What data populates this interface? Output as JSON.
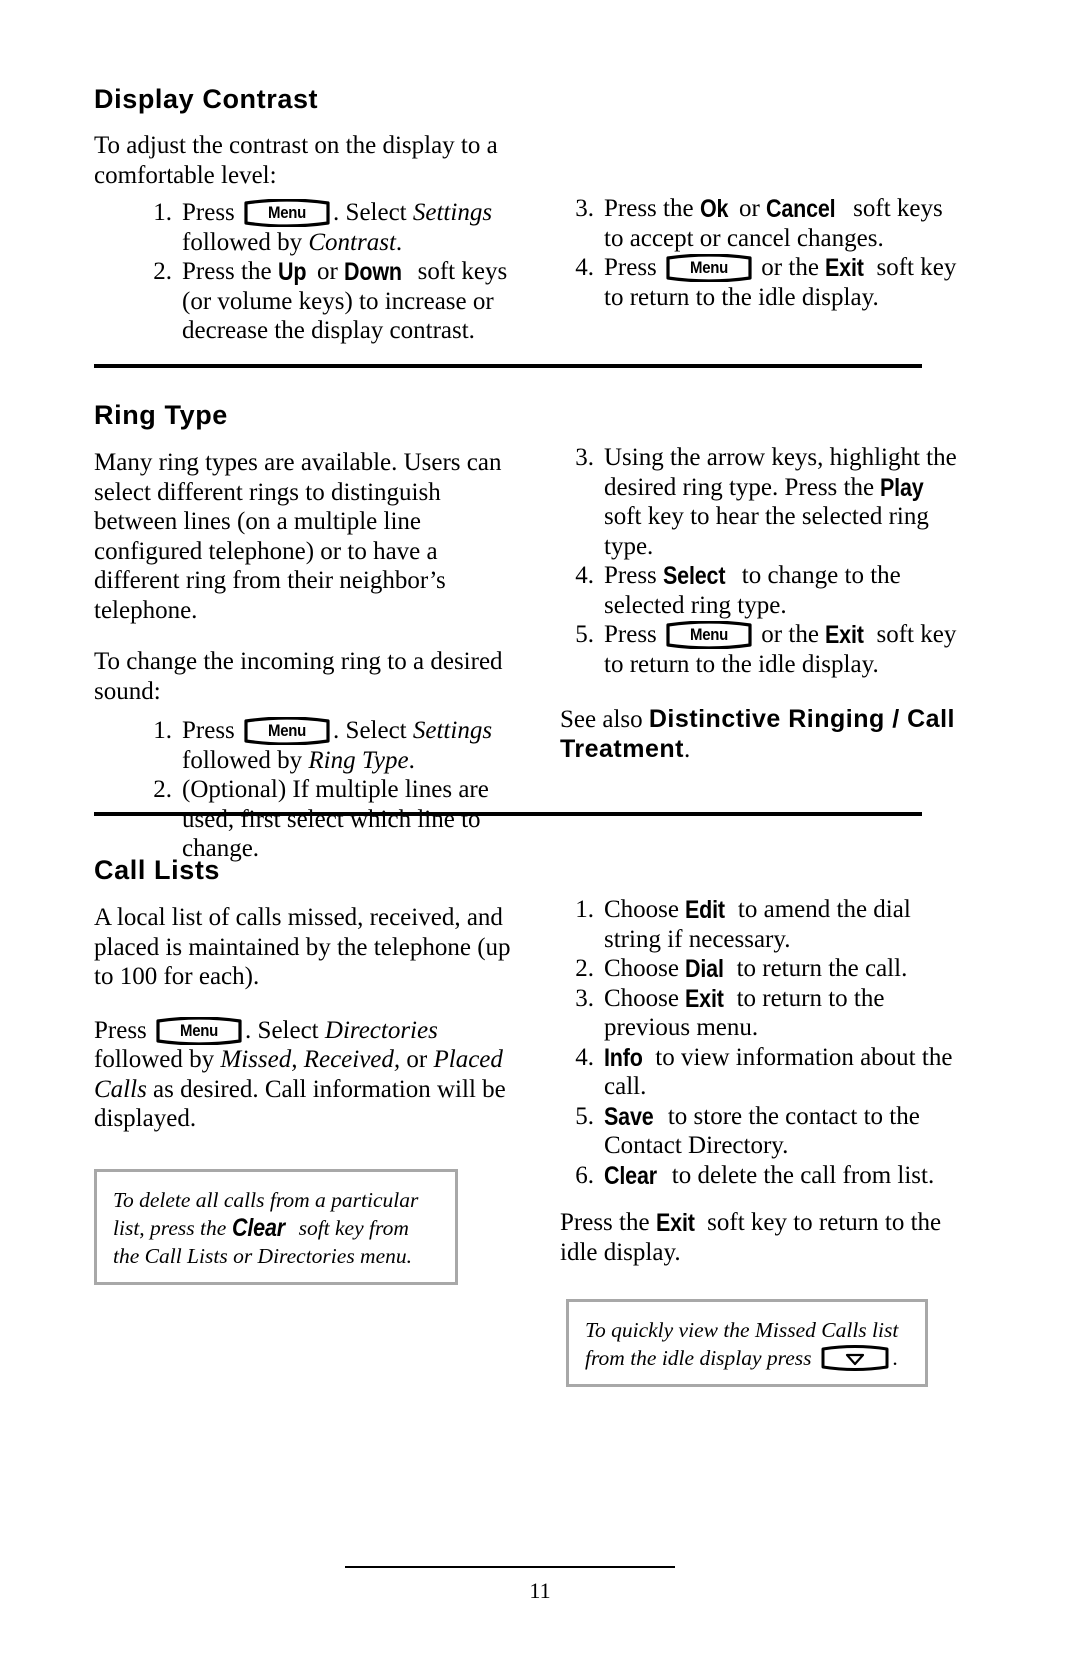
{
  "page": {
    "folio": "11",
    "menu_key_label": "Menu",
    "arrow_key_icon": "down-arrow-key-icon"
  },
  "sections": [
    {
      "id": "display-contrast",
      "heading": "Display Contrast",
      "intro": "To adjust the contrast on the display to a comfortable level:",
      "steps_left": [
        {
          "num": "1.",
          "parts": [
            {
              "t": "text",
              "v": "Press "
            },
            {
              "t": "key",
              "v": "Menu"
            },
            {
              "t": "text",
              "v": ". Select "
            },
            {
              "t": "italic",
              "v": "Settings"
            },
            {
              "t": "text",
              "v": " followed by "
            },
            {
              "t": "italic",
              "v": "Contrast"
            },
            {
              "t": "text",
              "v": "."
            }
          ]
        },
        {
          "num": "2.",
          "parts": [
            {
              "t": "text",
              "v": "Press the "
            },
            {
              "t": "softkey",
              "v": "Up"
            },
            {
              "t": "text",
              "v": " or "
            },
            {
              "t": "softkey",
              "v": "Down"
            },
            {
              "t": "text",
              "v": " soft keys (or volume keys) to increase or decrease the display contrast."
            }
          ]
        }
      ],
      "steps_right": [
        {
          "num": "3.",
          "parts": [
            {
              "t": "text",
              "v": "Press the "
            },
            {
              "t": "softkey",
              "v": "Ok"
            },
            {
              "t": "text",
              "v": " or "
            },
            {
              "t": "softkey",
              "v": "Cancel"
            },
            {
              "t": "text",
              "v": " soft keys to accept or cancel changes."
            }
          ]
        },
        {
          "num": "4.",
          "parts": [
            {
              "t": "text",
              "v": "Press "
            },
            {
              "t": "key",
              "v": "Menu"
            },
            {
              "t": "text",
              "v": " or the "
            },
            {
              "t": "softkey",
              "v": "Exit"
            },
            {
              "t": "text",
              "v": " soft key to return to the idle display."
            }
          ]
        }
      ]
    },
    {
      "id": "ring-type",
      "heading": "Ring Type",
      "intro": "Many ring types are available.  Users can select different rings to distinguish between lines (on a multiple line configured telephone) or to have a different ring from their neighbor’s telephone.",
      "intro2": "To change the incoming ring to a desired sound:",
      "steps_left": [
        {
          "num": "1.",
          "parts": [
            {
              "t": "text",
              "v": "Press "
            },
            {
              "t": "key",
              "v": "Menu"
            },
            {
              "t": "text",
              "v": ". Select "
            },
            {
              "t": "italic",
              "v": "Settings"
            },
            {
              "t": "text",
              "v": " followed by "
            },
            {
              "t": "italic",
              "v": "Ring Type"
            },
            {
              "t": "text",
              "v": "."
            }
          ]
        },
        {
          "num": "2.",
          "parts": [
            {
              "t": "text",
              "v": "(Optional)  If multiple lines are used, first select which line to change."
            }
          ]
        }
      ],
      "steps_right": [
        {
          "num": "3.",
          "parts": [
            {
              "t": "text",
              "v": "Using the arrow keys, highlight the desired ring type.  Press the "
            },
            {
              "t": "softkey",
              "v": "Play"
            },
            {
              "t": "text",
              "v": " soft key to hear the selected ring type."
            }
          ]
        },
        {
          "num": "4.",
          "parts": [
            {
              "t": "text",
              "v": "Press "
            },
            {
              "t": "softkey",
              "v": "Select"
            },
            {
              "t": "text",
              "v": " to change to the selected ring type."
            }
          ]
        },
        {
          "num": "5.",
          "parts": [
            {
              "t": "text",
              "v": "Press "
            },
            {
              "t": "key",
              "v": "Menu"
            },
            {
              "t": "text",
              "v": " or the "
            },
            {
              "t": "softkey",
              "v": "Exit"
            },
            {
              "t": "text",
              "v": " soft key to return to the idle display."
            }
          ]
        }
      ],
      "see_also": {
        "lead": "See also ",
        "target": "Distinctive Ringing / Call Treatment",
        "trail": "."
      }
    },
    {
      "id": "call-lists",
      "heading": "Call Lists",
      "intro": "A local list of calls missed, received, and placed is maintained by the telephone (up to 100 for each).",
      "intro2_parts": [
        {
          "t": "text",
          "v": "Press "
        },
        {
          "t": "key",
          "v": "Menu"
        },
        {
          "t": "text",
          "v": ". Select "
        },
        {
          "t": "italic",
          "v": "Directories"
        },
        {
          "t": "text",
          "v": " followed by "
        },
        {
          "t": "italic",
          "v": "Missed, Received,"
        },
        {
          "t": "text",
          "v": " or "
        },
        {
          "t": "italic",
          "v": "Placed Calls"
        },
        {
          "t": "text",
          "v": " as desired.  Call information will be displayed."
        }
      ],
      "note_left_parts": [
        {
          "t": "text",
          "v": "To delete all calls from a particular list, press the "
        },
        {
          "t": "softkey",
          "v": "Clear"
        },
        {
          "t": "text",
          "v": " soft key from the Call Lists or Directories menu."
        }
      ],
      "steps_right": [
        {
          "num": "1.",
          "parts": [
            {
              "t": "text",
              "v": "Choose "
            },
            {
              "t": "softkey",
              "v": "Edit"
            },
            {
              "t": "text",
              "v": " to amend the dial string if necessary."
            }
          ]
        },
        {
          "num": "2.",
          "parts": [
            {
              "t": "text",
              "v": "Choose "
            },
            {
              "t": "softkey",
              "v": "Dial"
            },
            {
              "t": "text",
              "v": " to return the call."
            }
          ]
        },
        {
          "num": "3.",
          "parts": [
            {
              "t": "text",
              "v": "Choose "
            },
            {
              "t": "softkey",
              "v": "Exit"
            },
            {
              "t": "text",
              "v": " to return to the previous menu."
            }
          ]
        },
        {
          "num": "4.",
          "parts": [
            {
              "t": "softkey",
              "v": "Info"
            },
            {
              "t": "text",
              "v": " to view information about the call."
            }
          ]
        },
        {
          "num": "5.",
          "parts": [
            {
              "t": "softkey",
              "v": "Save"
            },
            {
              "t": "text",
              "v": " to store the contact to the Contact Directory."
            }
          ]
        },
        {
          "num": "6.",
          "parts": [
            {
              "t": "softkey",
              "v": "Clear"
            },
            {
              "t": "text",
              "v": " to delete the call from list."
            }
          ]
        }
      ],
      "closing_parts": [
        {
          "t": "text",
          "v": "Press the "
        },
        {
          "t": "softkey",
          "v": "Exit"
        },
        {
          "t": "text",
          "v": " soft key to return to the idle display."
        }
      ],
      "note_right_parts": [
        {
          "t": "text",
          "v": "To quickly view the Missed Calls list from the idle display press "
        },
        {
          "t": "arrowkey",
          "v": "down-arrow-key-icon"
        },
        {
          "t": "text",
          "v": "."
        }
      ]
    }
  ]
}
